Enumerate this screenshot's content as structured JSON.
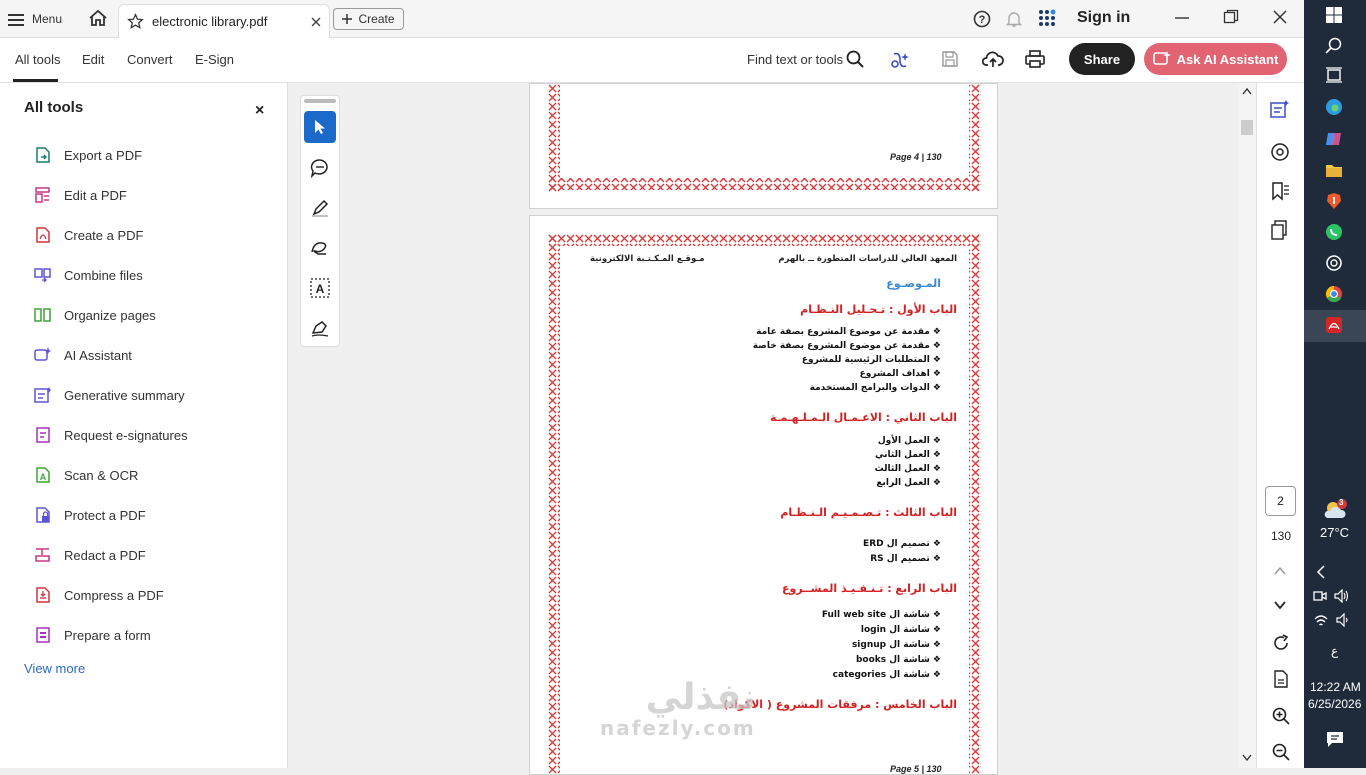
{
  "titlebar": {
    "menu_label": "Menu",
    "tab_title": "electronic library.pdf",
    "create_label": "Create",
    "signin_label": "Sign in"
  },
  "toolbar": {
    "tabs": [
      "All tools",
      "Edit",
      "Convert",
      "E-Sign"
    ],
    "find_label": "Find text or tools",
    "share_label": "Share",
    "ai_label": "Ask AI Assistant"
  },
  "panel": {
    "title": "All tools",
    "close": "×",
    "items": [
      "Export a PDF",
      "Edit a PDF",
      "Create a PDF",
      "Combine files",
      "Organize pages",
      "AI Assistant",
      "Generative summary",
      "Request e-signatures",
      "Scan & OCR",
      "Protect a PDF",
      "Redact a PDF",
      "Compress a PDF",
      "Prepare a form"
    ],
    "view_more": "View more"
  },
  "document": {
    "page4_footer": "Page 4 | 130",
    "header_right": "المعهد العالي للدراسات المتطورة ــ بالهرم",
    "header_left": "مـوقـع المـكـتـبة الالكترونية",
    "title": "المـوضـوع",
    "chapter1": "الباب الأول : تـحـليل النـظـام",
    "ch1_items": [
      "مقدمة عن موضوع المشروع بصفة عامة",
      "مقدمة عن موضوع المشروع بصفة خاصة",
      "المتطلبات الرئيسية للمشروع",
      "اهداف المشروع",
      "الدوات والبرامج المستخدمة"
    ],
    "chapter2": "الباب الثاني : الاعـمـال الـمـلـهـمـة",
    "ch2_items": [
      "العمل الأول",
      "العمل الثاني",
      "العمل الثالث",
      "العمل الرابع"
    ],
    "chapter3": "الباب الثالث : تـصـمـيـم الـنـظـام",
    "ch3_items": [
      "تصميم ال ERD",
      "تصميم ال RS"
    ],
    "chapter4": "الباب الرابع : تـنـفـيـذ المشــروع",
    "ch4_items": [
      "شاشة ال Full web site",
      "شاشة ال login",
      "شاشة ال signup",
      "شاشة ال books",
      "شاشة ال categories"
    ],
    "chapter5": "الباب الخامس : مرفقات المشروع ( الاكواد)",
    "page5_footer": "Page 5 | 130",
    "watermark_ar": "نفذلي",
    "watermark_en": "nafezly.com"
  },
  "navigation": {
    "current_page": "2",
    "total_pages": "130"
  },
  "taskbar": {
    "temp": "27°C",
    "weather_badge": "3",
    "lang": "ع",
    "time": "12:22 AM",
    "date": "6/25/2026"
  },
  "colors": {
    "accent": "#1b6ac9",
    "ai": "#e26472",
    "chapter_red": "#d42020",
    "title_blue": "#3a8ad0",
    "taskbar": "#1f2b3a"
  }
}
